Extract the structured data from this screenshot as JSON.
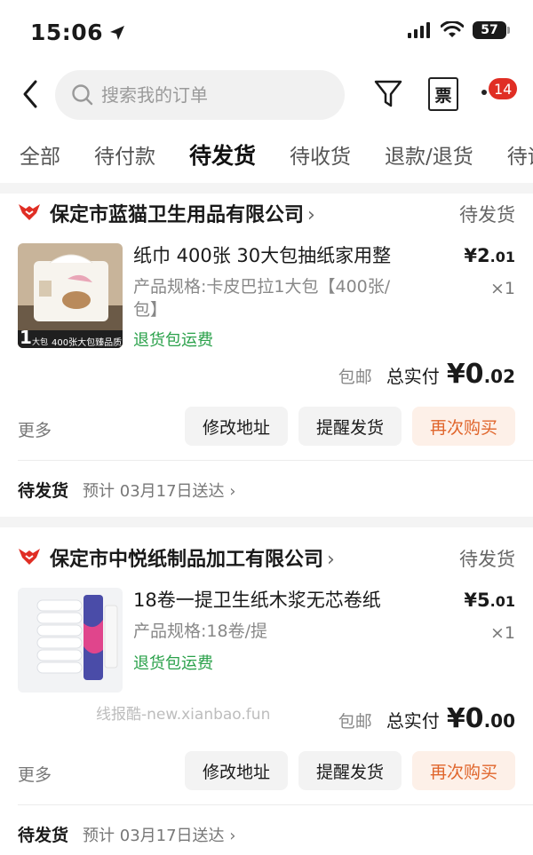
{
  "status_bar": {
    "time": "15:06",
    "battery": "57"
  },
  "header": {
    "search_placeholder": "搜索我的订单",
    "invoice_label": "票",
    "message_count": "14"
  },
  "tabs": [
    "全部",
    "待付款",
    "待发货",
    "待收货",
    "退款/退货",
    "待评价"
  ],
  "active_tab": "待发货",
  "orders": [
    {
      "shop": "保定市蓝猫卫生用品有限公司",
      "status": "待发货",
      "title": "纸巾 400张 30大包抽纸家用整",
      "spec": "产品规格:卡皮巴拉1大包【400张/包】",
      "tag": "退货包运费",
      "price_int": "¥2",
      "price_dec": ".01",
      "qty": "×1",
      "shipping": "包邮",
      "total_label": "总实付",
      "total_int": "¥0",
      "total_dec": ".02",
      "more": "更多",
      "btn_address": "修改地址",
      "btn_remind": "提醒发货",
      "btn_rebuy": "再次购买",
      "ship_status": "待发货",
      "ship_eta": "预计 03月17日送达",
      "thumb_text_num": "1",
      "thumb_text_unit": "大包",
      "thumb_text_caption": "400张大包臻品质"
    },
    {
      "shop": "保定市中悦纸制品加工有限公司",
      "status": "待发货",
      "title": "18卷一提卫生纸木浆无芯卷纸",
      "spec": "产品规格:18卷/提",
      "tag": "退货包运费",
      "price_int": "¥5",
      "price_dec": ".01",
      "qty": "×1",
      "shipping": "包邮",
      "total_label": "总实付",
      "total_int": "¥0",
      "total_dec": ".00",
      "more": "更多",
      "btn_address": "修改地址",
      "btn_remind": "提醒发货",
      "btn_rebuy": "再次购买",
      "ship_status": "待发货",
      "ship_eta": "预计 03月17日送达"
    }
  ],
  "watermark": "线报酷-new.xianbao.fun",
  "colors": {
    "accent": "#e02e24",
    "rebuy_text": "#e0652b",
    "tag_green": "#2aa14a"
  }
}
